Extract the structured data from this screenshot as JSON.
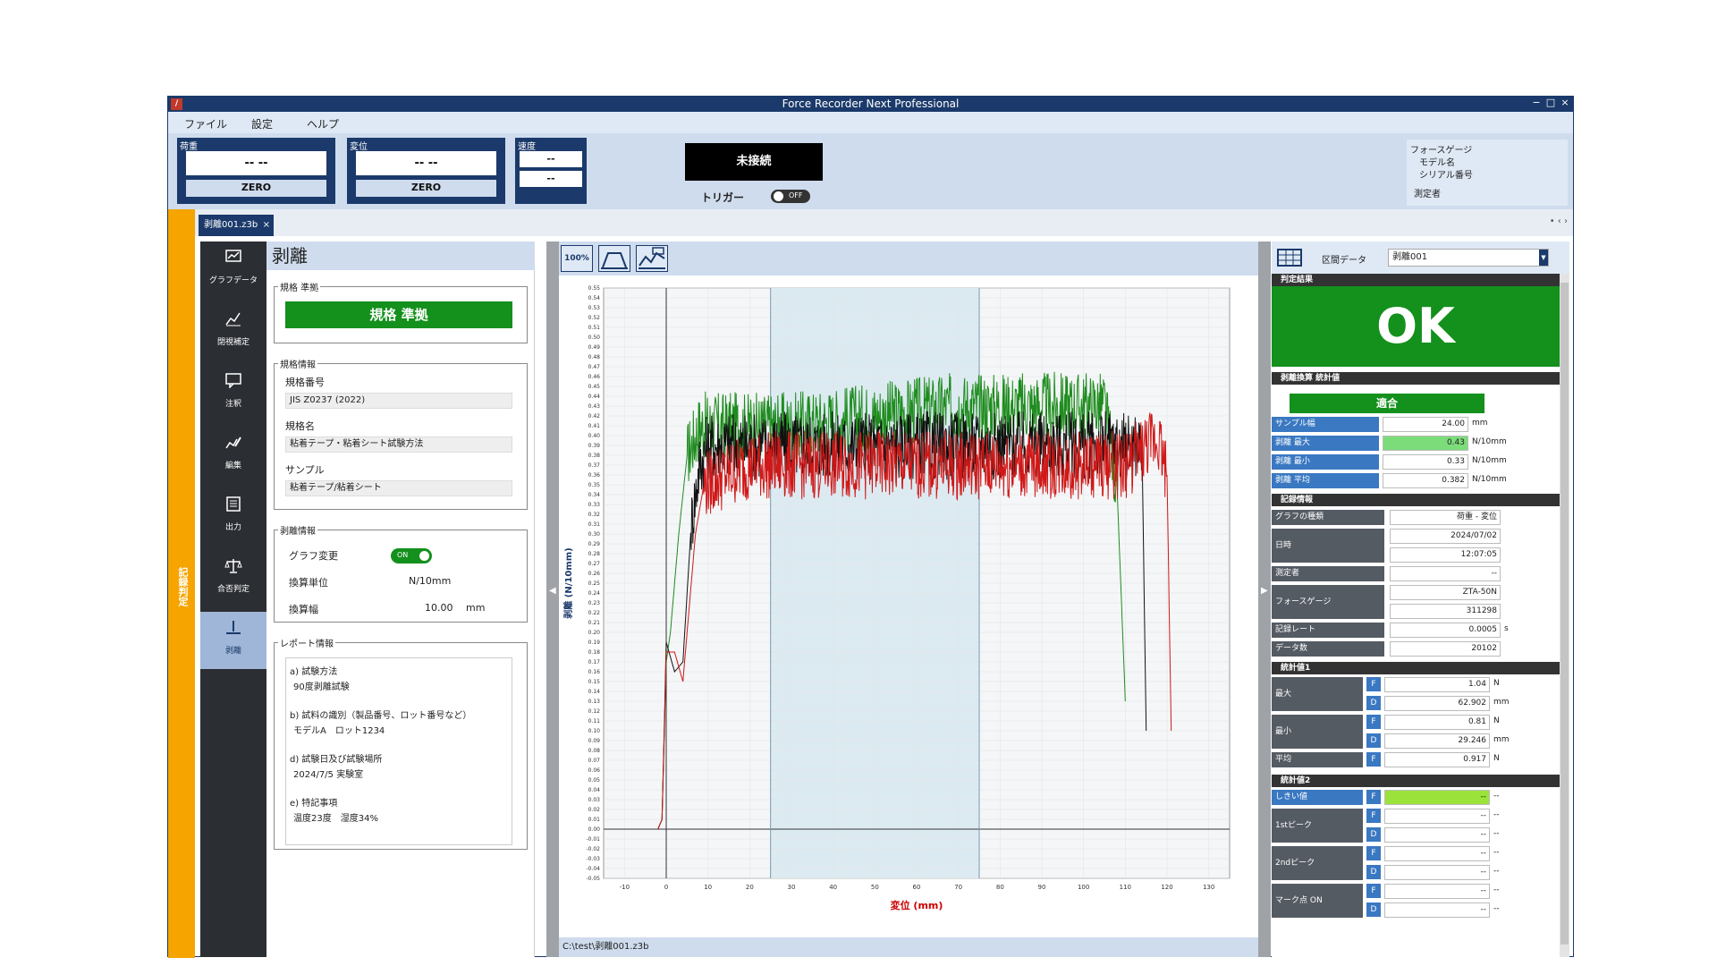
{
  "window": {
    "title": "Force Recorder Next Professional",
    "controls": [
      "−",
      "□",
      "×"
    ]
  },
  "menu": [
    "ファイル",
    "設定",
    "ヘルプ"
  ],
  "meters": {
    "load": {
      "label": "荷重",
      "value": "-- --",
      "zero": "ZERO"
    },
    "disp": {
      "label": "変位",
      "value": "-- --",
      "zero": "ZERO"
    },
    "speed": {
      "label": "速度",
      "value1": "--",
      "value2": "--"
    }
  },
  "connection": {
    "status": "未接続",
    "trigger_label": "トリガー",
    "trigger_state": "OFF"
  },
  "gauge_info": {
    "title": "フォースゲージ",
    "model": "モデル名",
    "serial": "シリアル番号",
    "operator": "測定者"
  },
  "left_strip": "記録判定",
  "tab": {
    "name": "剥離001.z3b",
    "close": "×",
    "more": "• ‹ ›"
  },
  "sidebar": [
    {
      "label": "グラフデータ",
      "icon": "graph-data-icon"
    },
    {
      "label": "閉視補定",
      "icon": "correction-icon"
    },
    {
      "label": "注釈",
      "icon": "annotation-icon"
    },
    {
      "label": "編集",
      "icon": "edit-icon"
    },
    {
      "label": "出力",
      "icon": "output-icon"
    },
    {
      "label": "合否判定",
      "icon": "scale-icon"
    },
    {
      "label": "剥離",
      "icon": "peel-icon"
    }
  ],
  "panel": {
    "title": "剥離",
    "std_group": "規格 準拠",
    "std_result": "規格 準拠",
    "info_group": "規格情報",
    "std_no_label": "規格番号",
    "std_no": "JIS Z0237 (2022)",
    "std_name_label": "規格名",
    "std_name": "粘着テープ・粘着シート試験方法",
    "sample_label": "サンプル",
    "sample": "粘着テープ/粘着シート",
    "peel_group": "剥離情報",
    "graph_change": "グラフ変更",
    "graph_toggle": "ON",
    "conv_unit_label": "換算単位",
    "conv_unit": "N/10mm",
    "conv_width_label": "換算幅",
    "conv_width": "10.00",
    "conv_width_unit": "mm",
    "report_group": "レポート情報",
    "report": [
      "a) 試験方法",
      "90度剥離試験",
      "b) 試料の識別（製品番号、ロット番号など）",
      "モデルA　ロット1234",
      "d) 試験日及び試験場所",
      "2024/7/5 実験室",
      "e) 特記事項",
      "温度23度　湿度34%"
    ]
  },
  "graph": {
    "tools": [
      "100%",
      "",
      ""
    ],
    "path": "C:\\test\\剥離001.z3b"
  },
  "chart_data": {
    "type": "line",
    "xlabel": "変位 (mm)",
    "ylabel": "剥離 (N/10mm)",
    "xlim": [
      -15,
      135
    ],
    "ylim": [
      -0.05,
      0.55
    ],
    "x_ticks": [
      -10,
      0,
      10,
      20,
      30,
      40,
      50,
      60,
      70,
      80,
      90,
      100,
      110,
      120,
      130
    ],
    "y_ticks_step": 0.01,
    "grid": true,
    "highlight_range": [
      25,
      75
    ],
    "markers_x": [
      0,
      25,
      75
    ],
    "series": [
      {
        "color": "#1e8c1e",
        "points": [
          [
            -2,
            0
          ],
          [
            -1,
            0.01
          ],
          [
            0,
            0.17
          ],
          [
            1,
            0.2
          ],
          [
            3,
            0.3
          ],
          [
            5,
            0.38
          ],
          [
            8,
            0.41
          ],
          [
            15,
            0.41
          ],
          [
            30,
            0.41
          ],
          [
            50,
            0.42
          ],
          [
            70,
            0.43
          ],
          [
            90,
            0.43
          ],
          [
            105,
            0.43
          ],
          [
            108,
            0.35
          ],
          [
            110,
            0.13
          ]
        ]
      },
      {
        "color": "#111111",
        "points": [
          [
            -2,
            0
          ],
          [
            -1,
            0.01
          ],
          [
            0,
            0.19
          ],
          [
            2,
            0.16
          ],
          [
            4,
            0.17
          ],
          [
            6,
            0.31
          ],
          [
            8,
            0.37
          ],
          [
            10,
            0.39
          ],
          [
            30,
            0.39
          ],
          [
            60,
            0.39
          ],
          [
            90,
            0.39
          ],
          [
            114,
            0.39
          ],
          [
            115,
            0.1
          ]
        ]
      },
      {
        "color": "#d01818",
        "points": [
          [
            -2,
            0
          ],
          [
            -1,
            0.01
          ],
          [
            0,
            0.18
          ],
          [
            2,
            0.18
          ],
          [
            4,
            0.15
          ],
          [
            5,
            0.2
          ],
          [
            7,
            0.3
          ],
          [
            9,
            0.35
          ],
          [
            20,
            0.37
          ],
          [
            50,
            0.37
          ],
          [
            80,
            0.37
          ],
          [
            110,
            0.37
          ],
          [
            118,
            0.4
          ],
          [
            120,
            0.36
          ],
          [
            121,
            0.1
          ]
        ]
      }
    ]
  },
  "right": {
    "toolbar_label": "区間データ",
    "dataset": "剥離001",
    "judge_title": "判定結果",
    "judge": "OK",
    "stats_title": "剥離換算 統計値",
    "stats_result": "適合",
    "stats": [
      {
        "label": "サンプル幅",
        "value": "24.00",
        "unit": "mm"
      },
      {
        "label": "剥離 最大",
        "value": "0.43",
        "unit": "N/10mm"
      },
      {
        "label": "剥離 最小",
        "value": "0.33",
        "unit": "N/10mm"
      },
      {
        "label": "剥離 平均",
        "value": "0.382",
        "unit": "N/10mm"
      }
    ],
    "record_title": "記録情報",
    "record": {
      "graph_type_label": "グラフの種類",
      "graph_type": "荷重 - 変位",
      "date_label": "日時",
      "date": "2024/07/02",
      "time": "12:07:05",
      "operator_label": "測定者",
      "operator": "--",
      "gauge_label": "フォースゲージ",
      "gauge_model": "ZTA-50N",
      "gauge_serial": "311298",
      "rate_label": "記録レート",
      "rate": "0.0005",
      "rate_unit": "s",
      "count_label": "データ数",
      "count": "20102"
    },
    "stat1_title": "統計値1",
    "stat1": {
      "max_label": "最大",
      "max_f": "1.04",
      "max_f_unit": "N",
      "max_d": "62.902",
      "max_d_unit": "mm",
      "min_label": "最小",
      "min_f": "0.81",
      "min_f_unit": "N",
      "min_d": "29.246",
      "min_d_unit": "mm",
      "avg_label": "平均",
      "avg_f": "0.917",
      "avg_f_unit": "N"
    },
    "stat2_title": "統計値2",
    "stat2": {
      "threshold_label": "しきい値",
      "peak1_label": "1stピーク",
      "peak2_label": "2ndピーク",
      "mark_label": "マーク点 ON",
      "empty": "--"
    },
    "F": "F",
    "D": "D"
  }
}
